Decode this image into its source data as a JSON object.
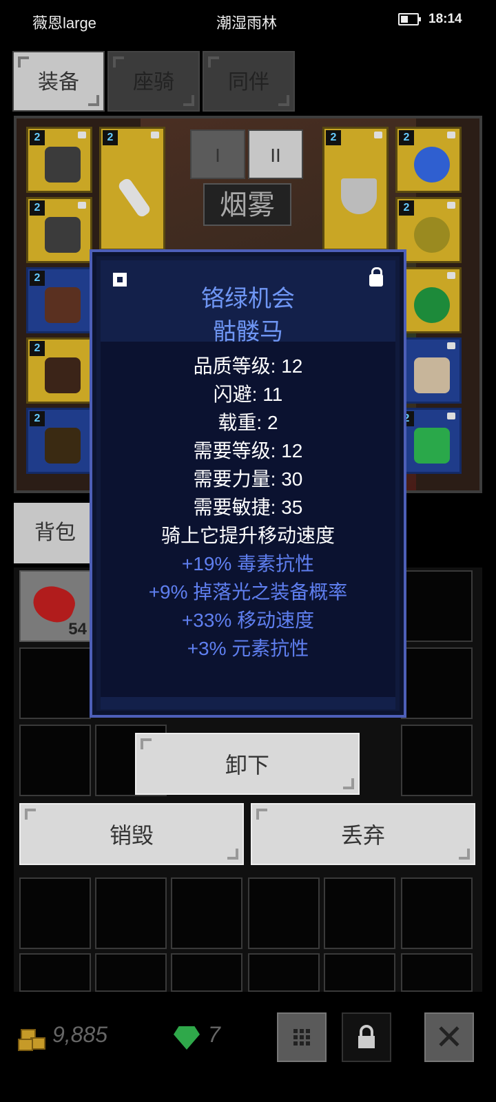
{
  "status_bar": {
    "carrier": "薇恩large",
    "location": "潮湿雨林",
    "time": "18:14"
  },
  "top_tabs": [
    {
      "label": "装备",
      "active": true
    },
    {
      "label": "座骑",
      "active": false
    },
    {
      "label": "同伴",
      "active": false
    }
  ],
  "equipment": {
    "quickslots": [
      {
        "label": "I",
        "active": false
      },
      {
        "label": "II",
        "active": true
      }
    ],
    "skill_name": "烟雾",
    "tier_label": "2"
  },
  "backpack": {
    "tab_label": "背包",
    "first_item_count": "54"
  },
  "tooltip": {
    "name": "铬绿机会",
    "type": "骷髅马",
    "stats": [
      "品质等级: 12",
      "闪避: 11",
      "载重: 2",
      "需要等级: 12",
      "需要力量: 30",
      "需要敏捷: 35",
      "骑上它提升移动速度"
    ],
    "bonuses": [
      "+19% 毒素抗性",
      "+9% 掉落光之装备概率",
      "+33% 移动速度",
      "+3% 元素抗性"
    ],
    "colors": {
      "title": "#6f96f4",
      "bonus": "#5f7ff0",
      "stat": "#ffffff"
    }
  },
  "actions": {
    "unequip": "卸下",
    "destroy": "销毁",
    "drop": "丢弃"
  },
  "currency": {
    "gold": "9,885",
    "gems": "7"
  }
}
